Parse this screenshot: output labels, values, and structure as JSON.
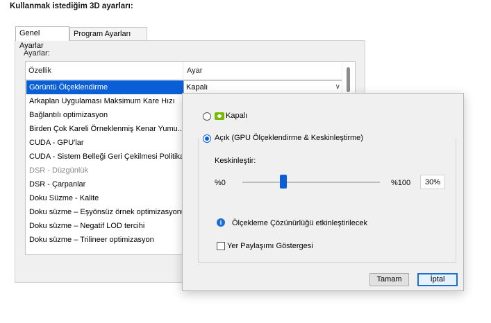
{
  "page": {
    "title": "Kullanmak istediğim 3D ayarları:"
  },
  "tabs": [
    {
      "label": "Genel Ayarlar",
      "active": true
    },
    {
      "label": "Program Ayarları",
      "active": false
    }
  ],
  "settings": {
    "label": "Ayarlar:",
    "columns": {
      "feature": "Özellik",
      "setting": "Ayar"
    },
    "rows": [
      {
        "feature": "Görüntü Ölçeklendirme",
        "value": "Kapalı",
        "selected": true
      },
      {
        "feature": "Arkaplan Uygulaması Maksimum Kare Hızı"
      },
      {
        "feature": "Bağlantılı optimizasyon"
      },
      {
        "feature": "Birden Çok Kareli Örneklenmiş Kenar Yumu..."
      },
      {
        "feature": "CUDA - GPU'lar"
      },
      {
        "feature": "CUDA - Sistem Belleği Geri Çekilmesi Politikası"
      },
      {
        "feature": "DSR - Düzgünlük",
        "disabled": true
      },
      {
        "feature": "DSR - Çarpanlar"
      },
      {
        "feature": "Doku Süzme - Kalite"
      },
      {
        "feature": "Doku süzme – Eşyönsüz örnek optimizasyonu"
      },
      {
        "feature": "Doku süzme – Negatif LOD tercihi"
      },
      {
        "feature": "Doku süzme – Trilineer optimizasyon"
      }
    ]
  },
  "popup": {
    "option_off": {
      "label": "Kapalı",
      "selected": false
    },
    "option_on": {
      "label": "Açık (GPU Ölçeklendirme & Keskinleştirme)",
      "selected": true
    },
    "sharpen": {
      "label": "Keskinleştir:",
      "min_label": "%0",
      "max_label": "%100",
      "value_label": "30%",
      "value_fraction": 0.3
    },
    "info_text": "Ölçekleme Çözünürlüğü etkinleştirilecek",
    "overlay_checkbox": {
      "label": "Yer Paylaşımı Göstergesi",
      "checked": false
    },
    "buttons": {
      "ok": "Tamam",
      "cancel": "İptal"
    }
  },
  "colors": {
    "accent": "#0a5fd6",
    "nvidia_green": "#76b900"
  },
  "icons": {
    "info": "info-icon",
    "nvidia": "nvidia-logo-icon",
    "dropdown": "chevron-down-icon"
  }
}
